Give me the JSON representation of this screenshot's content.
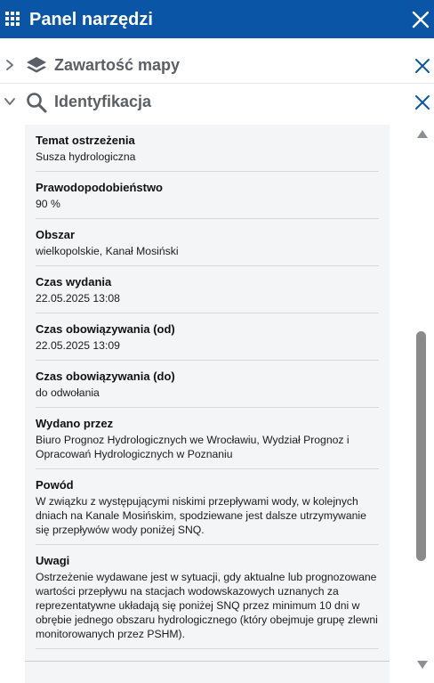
{
  "header": {
    "title": "Panel narzędzi",
    "bg_color": "#0b55a6",
    "menu_icon": "grid-icon",
    "close_icon": "close-icon"
  },
  "sections": [
    {
      "title": "Zawartość mapy",
      "icon": "layers-icon",
      "expanded": false
    },
    {
      "title": "Identyfikacja",
      "icon": "search-icon",
      "expanded": true
    }
  ],
  "identification": {
    "fields": [
      {
        "label": "Temat ostrzeżenia",
        "value": "Susza hydrologiczna"
      },
      {
        "label": "Prawodopodobieństwo",
        "value": "90 %"
      },
      {
        "label": "Obszar",
        "value": "wielkopolskie, Kanał Mosiński"
      },
      {
        "label": "Czas wydania",
        "value": "22.05.2025 13:08"
      },
      {
        "label": "Czas obowiązywania (od)",
        "value": "22.05.2025 13:09"
      },
      {
        "label": "Czas obowiązywania (do)",
        "value": "do odwołania"
      },
      {
        "label": "Wydano przez",
        "value": "Biuro Prognoz Hydrologicznych we Wrocławiu, Wydział Prognoz i Opracowań Hydrologicznych w Poznaniu"
      },
      {
        "label": "Powód",
        "value": "W związku z występującymi niskimi przepływami wody, w kolejnych dniach na Kanale Mosińskim, spodziewane jest dalsze utrzymywanie się przepływów wody poniżej SNQ."
      },
      {
        "label": "Uwagi",
        "value": "Ostrzeżenie wydawane jest w sytuacji, gdy aktualne lub prognozowane wartości przepływu na stacjach wodowskazowych uznanych za reprezentatywne układają się poniżej SNQ przez minimum 10 dni w obrębie jednego obszaru hydrologicznego (który obejmuje grupę zlewni monitorowanych przez PSHM)."
      }
    ]
  },
  "colors": {
    "accent": "#0b55a6",
    "section_title": "#5a5f66",
    "content_bg": "#f4f5f7"
  }
}
